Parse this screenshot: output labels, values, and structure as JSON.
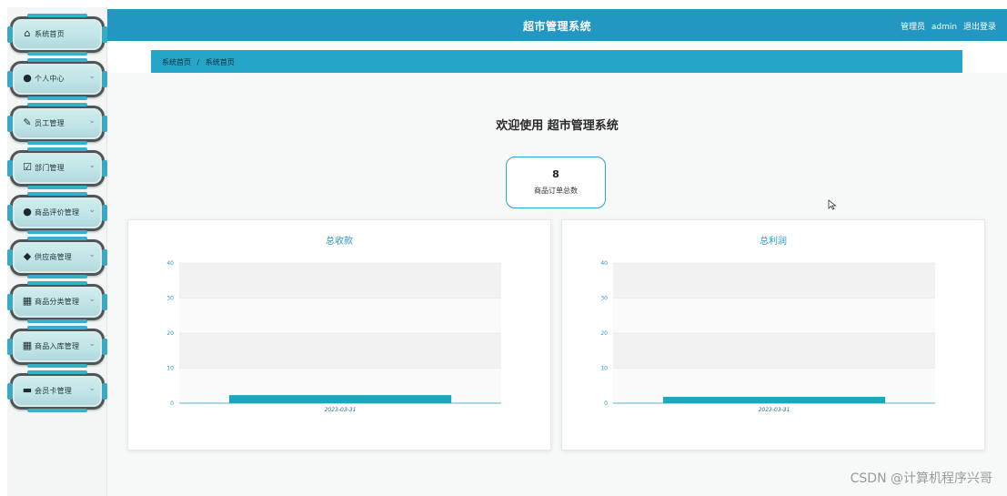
{
  "header": {
    "title": "超市管理系统",
    "role": "管理员",
    "username": "admin",
    "logout_label": "退出登录"
  },
  "breadcrumb": {
    "items": [
      "系统首页",
      "/",
      "系统首页"
    ]
  },
  "sidebar": {
    "items": [
      {
        "label": "系统首页",
        "icon": "home-icon",
        "has_chevron": false
      },
      {
        "label": "个人中心",
        "icon": "user-icon",
        "has_chevron": true
      },
      {
        "label": "员工管理",
        "icon": "edit-icon",
        "has_chevron": true
      },
      {
        "label": "部门管理",
        "icon": "checkbox-icon",
        "has_chevron": true
      },
      {
        "label": "商品评价管理",
        "icon": "user-icon",
        "has_chevron": true
      },
      {
        "label": "供应商管理",
        "icon": "location-icon",
        "has_chevron": true
      },
      {
        "label": "商品分类管理",
        "icon": "grid-icon",
        "has_chevron": true
      },
      {
        "label": "商品入库管理",
        "icon": "grid-icon",
        "has_chevron": true
      },
      {
        "label": "会员卡管理",
        "icon": "card-icon",
        "has_chevron": true
      }
    ]
  },
  "main": {
    "welcome": "欢迎使用 超市管理系统",
    "stat": {
      "value": "8",
      "label": "商品订单总数"
    }
  },
  "chart_data": [
    {
      "type": "bar",
      "title": "总收款",
      "categories": [
        "2023-03-31"
      ],
      "values": [
        2.3
      ],
      "ylim": [
        0,
        40
      ],
      "yticks": [
        0,
        10,
        20,
        30,
        40
      ],
      "color": "#1aa8bf",
      "grid": true
    },
    {
      "type": "bar",
      "title": "总利润",
      "categories": [
        "2023-03-31"
      ],
      "values": [
        1.8
      ],
      "ylim": [
        0,
        40
      ],
      "yticks": [
        0,
        10,
        20,
        30,
        40
      ],
      "color": "#1aa8bf",
      "grid": true
    }
  ],
  "watermark": "CSDN @计算机程序兴哥",
  "colors": {
    "accent": "#2197c1",
    "crumb": "#25a6c8",
    "bar": "#1aa8bf"
  }
}
